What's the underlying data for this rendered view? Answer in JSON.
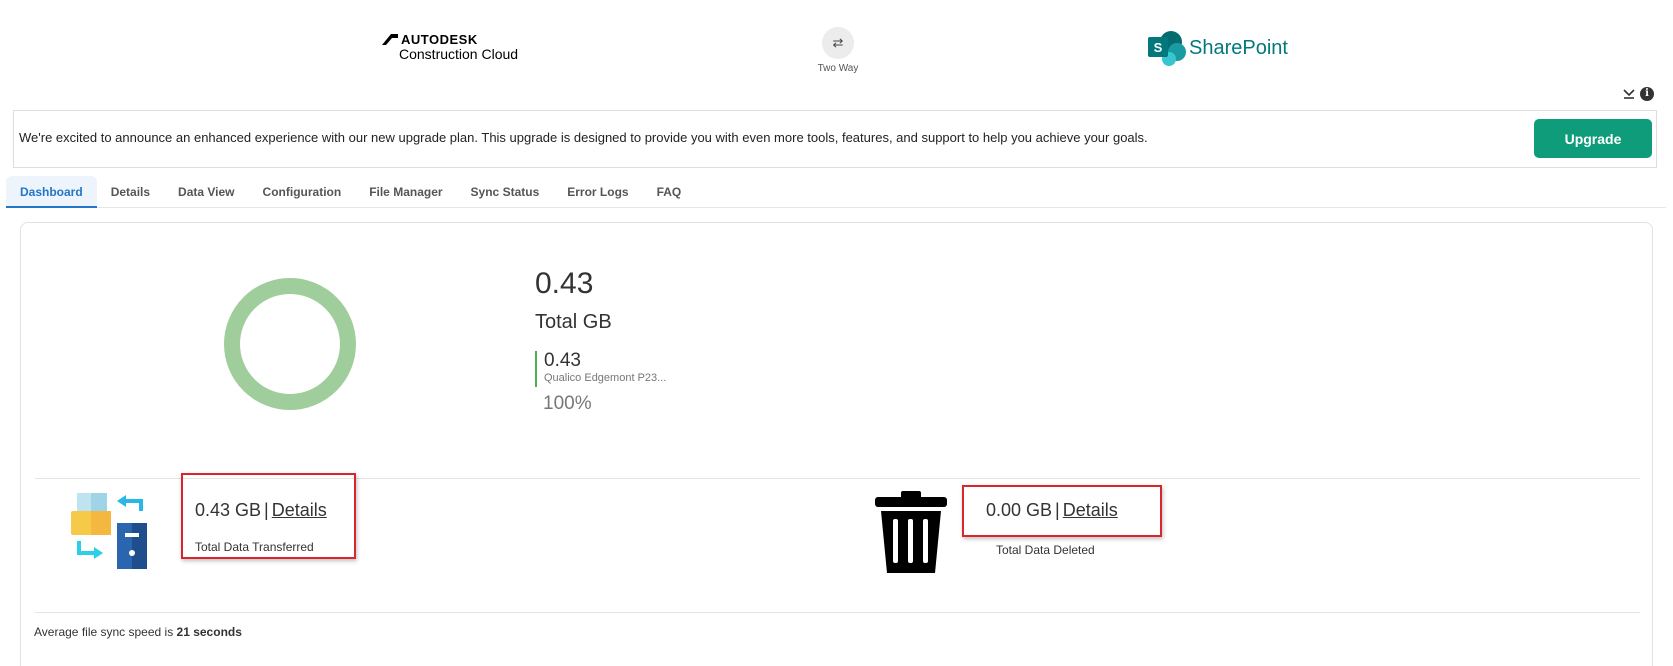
{
  "header": {
    "left_logo": {
      "brand": "AUTODESK",
      "product": "Construction Cloud"
    },
    "sync_mode": {
      "icon": "two-way-arrows-icon",
      "label": "Two Way"
    },
    "right_logo": {
      "letter": "S",
      "product": "SharePoint"
    },
    "utility_icons": [
      "download-icon",
      "info-icon"
    ]
  },
  "announcement": {
    "text": "We're excited to announce an enhanced experience with our new upgrade plan. This upgrade is designed to provide you with even more tools, features, and support to help you achieve your goals.",
    "button_label": "Upgrade"
  },
  "tabs": [
    {
      "label": "Dashboard",
      "active": true
    },
    {
      "label": "Details"
    },
    {
      "label": "Data View"
    },
    {
      "label": "Configuration"
    },
    {
      "label": "File Manager"
    },
    {
      "label": "Sync Status"
    },
    {
      "label": "Error Logs"
    },
    {
      "label": "FAQ"
    }
  ],
  "summary": {
    "total_value": "0.43",
    "total_label": "Total GB",
    "legend": [
      {
        "value": "0.43",
        "name": "Qualico Edgemont P23...",
        "percent": "100%",
        "color": "#9fcd9b"
      }
    ]
  },
  "chart_data": {
    "type": "pie",
    "donut": true,
    "labels": [
      "Qualico Edgemont P23..."
    ],
    "values": [
      0.43
    ],
    "colors": [
      "#9fcd9b"
    ],
    "title": "",
    "center_value": "0.43",
    "center_label": "Total GB"
  },
  "stats": {
    "transferred": {
      "value": "0.43 GB",
      "sep": "|",
      "link": "Details",
      "label": "Total Data Transferred",
      "icon": "file-transfer-icon"
    },
    "deleted": {
      "value": "0.00 GB",
      "sep": "|",
      "link": "Details",
      "label": "Total Data Deleted",
      "icon": "trash-icon"
    }
  },
  "footer": {
    "avg_prefix": "Average file sync speed is ",
    "avg_value": "21 seconds"
  },
  "colors": {
    "accent_blue": "#2176c6",
    "upgrade_green": "#0e9c7b",
    "sharepoint_teal": "#03787c",
    "highlight_red": "#d9262b",
    "legend_green": "#4caf50"
  }
}
